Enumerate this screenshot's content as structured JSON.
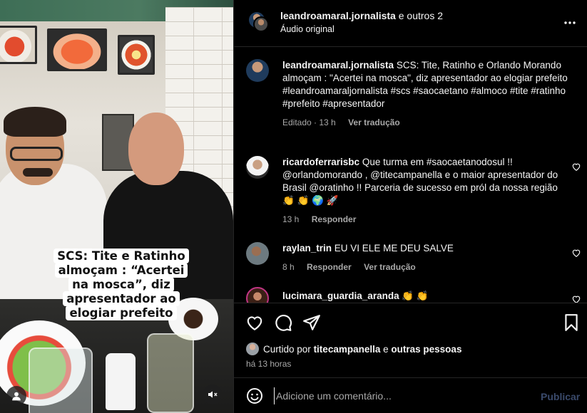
{
  "header": {
    "username": "leandroamaral.jornalista",
    "others": "e outros 2",
    "audio": "Áudio original",
    "more_icon": "more-horizontal-icon"
  },
  "video": {
    "caption_overlay": "SCS: Tite e Ratinho almoçam : “Acertei na mosca”, diz apresentador ao elogiar prefeito",
    "user_tag_icon": "user-icon",
    "mute_icon": "speaker-muted-icon"
  },
  "post": {
    "username": "leandroamaral.jornalista",
    "text": "SCS: Tite, Ratinho e Orlando Morando almoçam : \"Acertei na mosca\", diz apresentador ao elogiar prefeito",
    "hashtags": "#leandroamaraljornalista #scs #saocaetano #almoco #tite #ratinho #prefeito #apresentador",
    "edited": "Editado · 13 h",
    "see_translation": "Ver tradução"
  },
  "comments": [
    {
      "username": "ricardoferrarisbc",
      "text": "Que turma em #saocaetanodosul !! @orlandomorando , @titecampanella e o maior apresentador do Brasil @oratinho !! Parceria de sucesso em pról da nossa região 👏 👏 🌍 🚀",
      "time": "13 h",
      "reply": "Responder",
      "translation": ""
    },
    {
      "username": "raylan_trin",
      "text": "EU VI ELE ME DEU SALVE",
      "time": "8 h",
      "reply": "Responder",
      "translation": "Ver tradução"
    },
    {
      "username": "lucimara_guardia_aranda",
      "text": "👏 👏",
      "time": "",
      "reply": "",
      "translation": ""
    }
  ],
  "actions": {
    "like_icon": "heart-icon",
    "comment_icon": "comment-icon",
    "share_icon": "send-icon",
    "save_icon": "bookmark-icon",
    "liked_by_prefix": "Curtido por",
    "liked_by_user": "titecampanella",
    "liked_by_and": "e",
    "liked_by_others": "outras pessoas",
    "time_ago": "há 13 horas"
  },
  "composer": {
    "emoji_icon": "emoji-icon",
    "placeholder": "Adicione um comentário...",
    "publish": "Publicar"
  },
  "colors": {
    "background": "#000000",
    "text": "#f5f5f5",
    "muted": "#a8a8a8",
    "divider": "#262626",
    "publish_disabled": "#3a4a6b"
  }
}
